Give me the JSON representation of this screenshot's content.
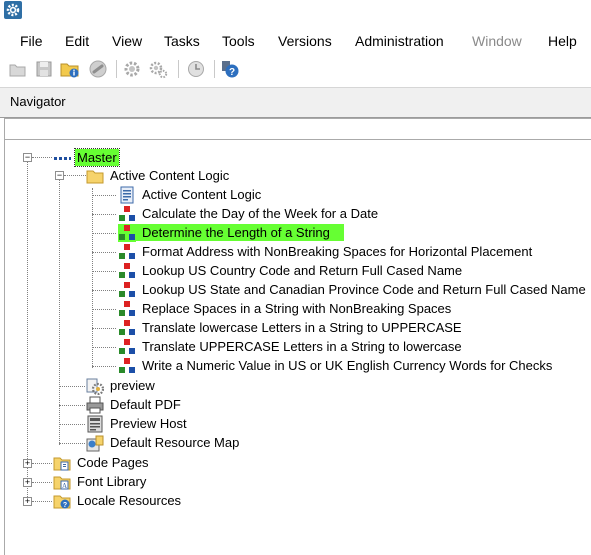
{
  "window": {
    "app_icon": "gear-icon"
  },
  "menu": [
    {
      "label": "File",
      "enabled": true
    },
    {
      "label": "Edit",
      "enabled": true
    },
    {
      "label": "View",
      "enabled": true
    },
    {
      "label": "Tasks",
      "enabled": true
    },
    {
      "label": "Tools",
      "enabled": true
    },
    {
      "label": "Versions",
      "enabled": true
    },
    {
      "label": "Administration",
      "enabled": true
    },
    {
      "label": "Window",
      "enabled": false
    },
    {
      "label": "Help",
      "enabled": true
    }
  ],
  "toolbar": {
    "buttons": [
      "open-folder-icon",
      "save-icon",
      "properties-icon",
      "link-icon",
      "settings-gear-icon",
      "settings-gears-icon",
      "history-icon",
      "help-icon"
    ]
  },
  "navigator": {
    "title": "Navigator"
  },
  "tree": {
    "root": {
      "label": "Master",
      "expanded": true,
      "icon": "master-dots-icon"
    },
    "folder": {
      "label": "Active Content Logic",
      "expanded": true,
      "icon": "folder-icon"
    },
    "folder_children": [
      {
        "label": "Active Content Logic",
        "icon": "document-icon"
      },
      {
        "label": "Calculate the Day of the Week for a Date",
        "icon": "logic-cubes-icon"
      },
      {
        "label": "Determine the Length of a String",
        "icon": "logic-cubes-icon",
        "highlighted": true
      },
      {
        "label": "Format Address with NonBreaking Spaces for Horizontal Placement",
        "icon": "logic-cubes-icon"
      },
      {
        "label": "Lookup US Country Code and Return Full Cased Name",
        "icon": "logic-cubes-icon"
      },
      {
        "label": "Lookup US State and Canadian Province Code and Return Full Cased Name",
        "icon": "logic-cubes-icon"
      },
      {
        "label": "Replace Spaces in a String with NonBreaking Spaces",
        "icon": "logic-cubes-icon"
      },
      {
        "label": "Translate lowercase Letters in a String to UPPERCASE",
        "icon": "logic-cubes-icon"
      },
      {
        "label": "Translate UPPERCASE Letters in a String to lowercase",
        "icon": "logic-cubes-icon"
      },
      {
        "label": "Write a Numeric Value in US or UK English Currency Words for Checks",
        "icon": "logic-cubes-icon"
      }
    ],
    "master_children": [
      {
        "label": "preview",
        "icon": "preview-settings-icon"
      },
      {
        "label": "Default PDF",
        "icon": "printer-icon"
      },
      {
        "label": "Preview Host",
        "icon": "preview-host-icon"
      },
      {
        "label": "Default Resource Map",
        "icon": "resource-map-icon"
      }
    ],
    "top_level": [
      {
        "label": "Code Pages",
        "icon": "code-pages-folder-icon",
        "expanded": false
      },
      {
        "label": "Font Library",
        "icon": "font-library-folder-icon",
        "expanded": false
      },
      {
        "label": "Locale Resources",
        "icon": "locale-resources-folder-icon",
        "expanded": false
      }
    ]
  },
  "colors": {
    "highlight": "#66ff33",
    "header_bg": "#f0f0f0"
  }
}
